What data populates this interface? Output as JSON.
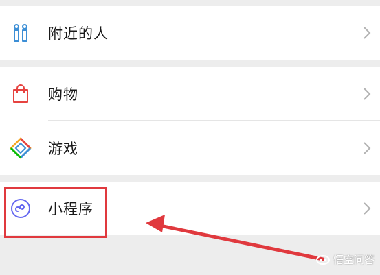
{
  "menu": {
    "nearby": {
      "label": "附近的人",
      "icon": "people-nearby-icon"
    },
    "shopping": {
      "label": "购物",
      "icon": "shopping-bag-icon"
    },
    "games": {
      "label": "游戏",
      "icon": "game-diamond-icon"
    },
    "mini_programs": {
      "label": "小程序",
      "icon": "mini-program-icon"
    }
  },
  "annotation": {
    "highlight_color": "#e0393e"
  },
  "watermark": {
    "text": "悟空问答"
  },
  "colors": {
    "background": "#ededed",
    "row": "#ffffff",
    "icon_blue": "#3d8fd6",
    "icon_red": "#e64340",
    "icon_purple": "#6467f0",
    "chevron": "#b2b2b2"
  }
}
